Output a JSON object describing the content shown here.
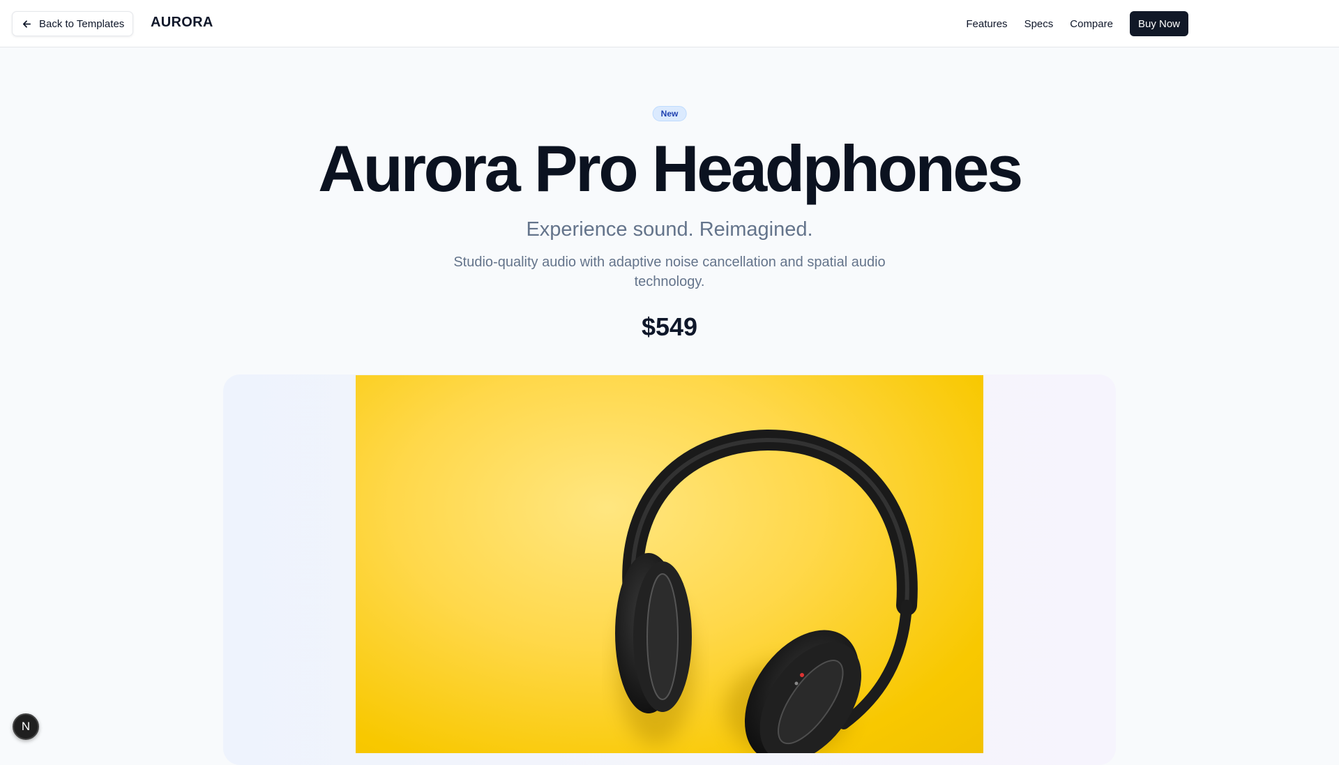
{
  "header": {
    "back_label": "Back to Templates",
    "brand": "AURORA",
    "nav": [
      {
        "label": "Features"
      },
      {
        "label": "Specs"
      },
      {
        "label": "Compare"
      }
    ],
    "cta_label": "Buy Now"
  },
  "hero": {
    "badge": "New",
    "title": "Aurora Pro Headphones",
    "subtitle": "Experience sound. Reimagined.",
    "description": "Studio-quality audio with adaptive noise cancellation and spatial audio technology.",
    "price": "$549"
  },
  "product_image": {
    "subject": "headphones-photo"
  },
  "floating": {
    "avatar_letter": "N"
  },
  "colors": {
    "accent": "#111827",
    "badge_bg": "#dbeafe",
    "badge_text": "#1e40af",
    "photo_bg": "#f8c800"
  }
}
